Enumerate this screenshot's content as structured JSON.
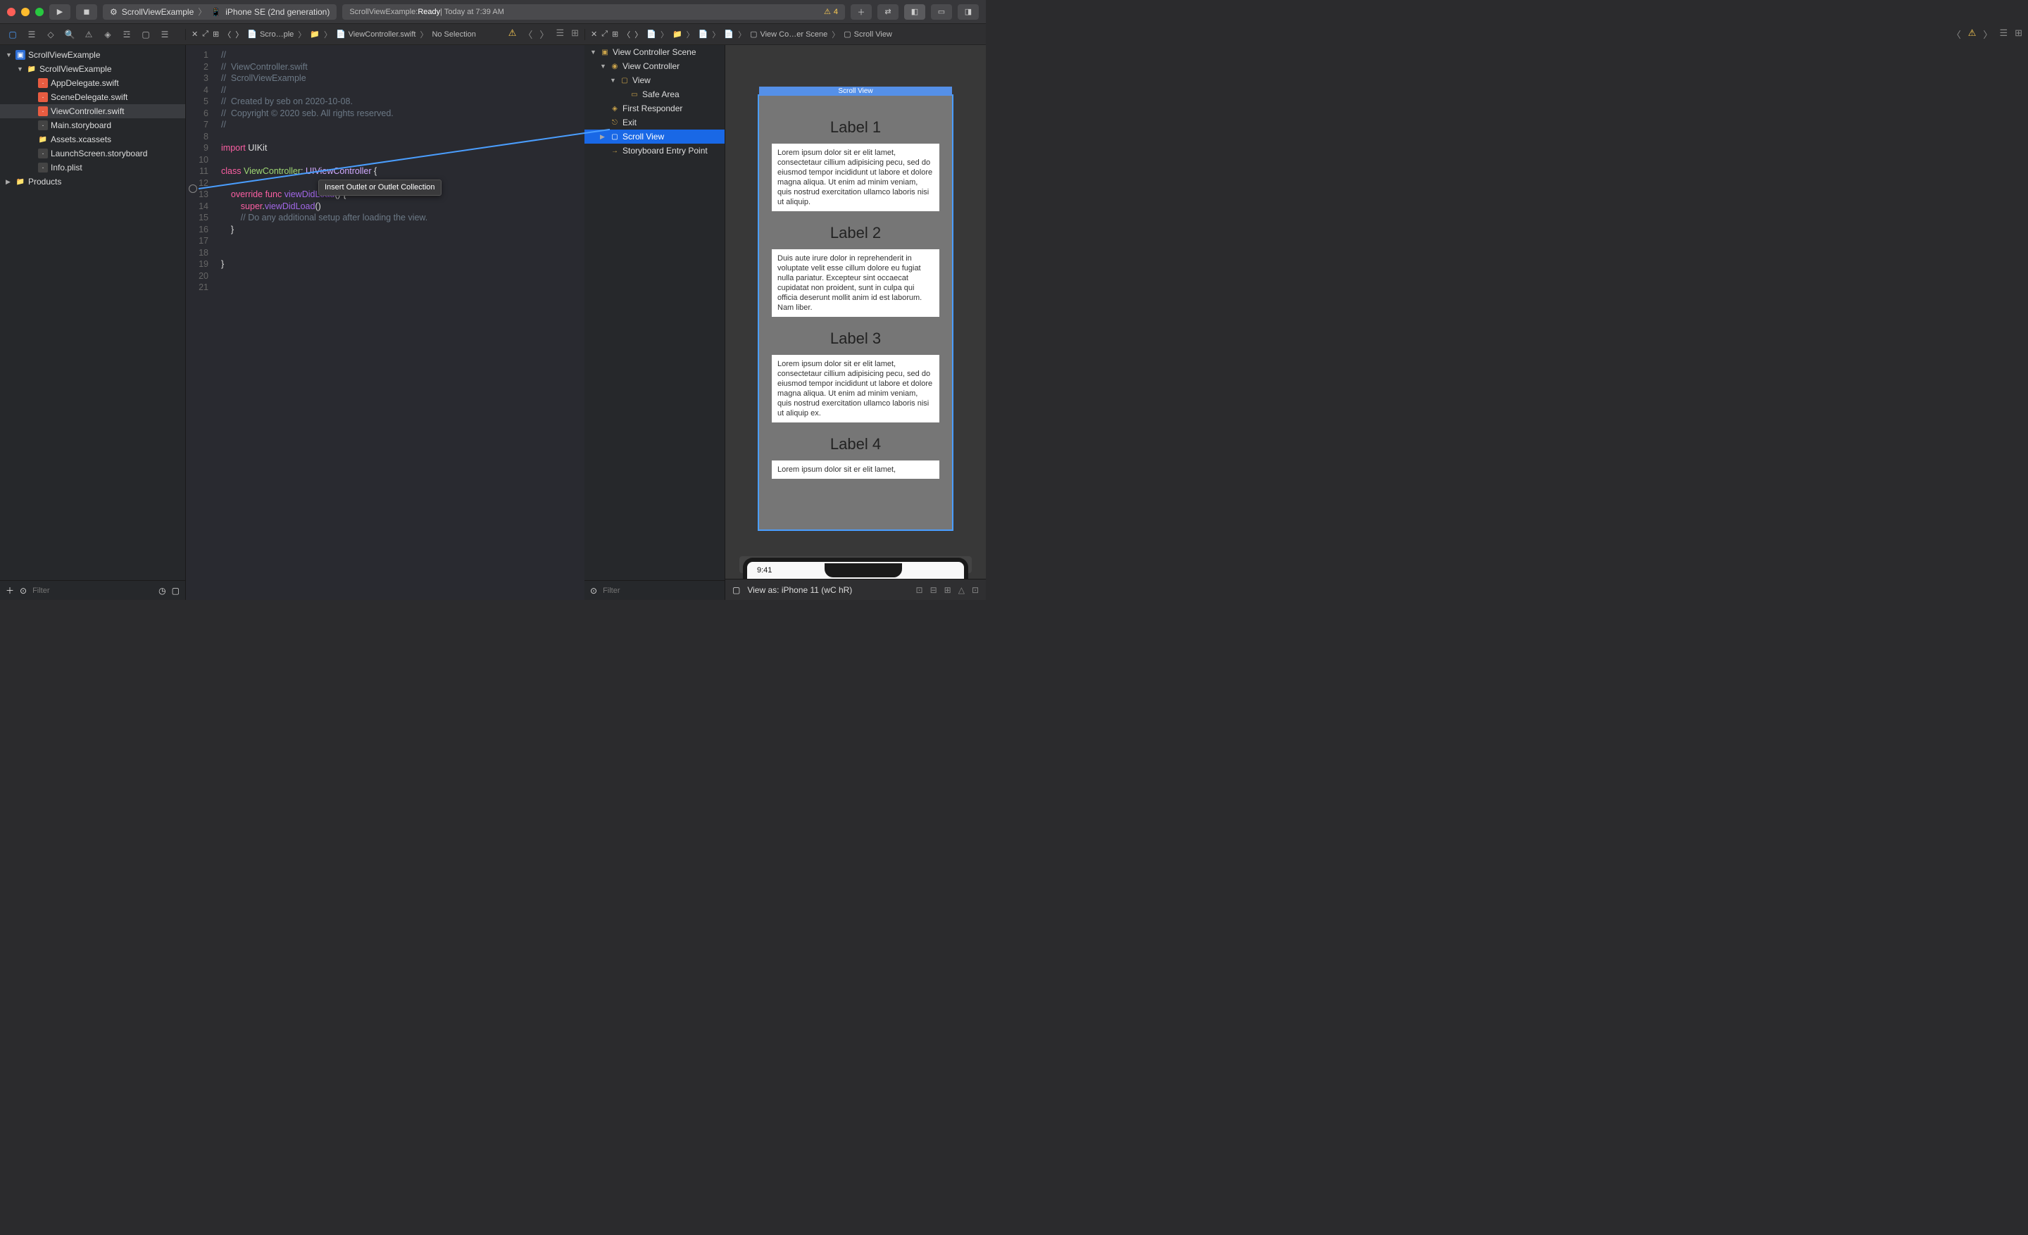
{
  "titlebar": {
    "scheme_project": "ScrollViewExample",
    "scheme_device": "iPhone SE (2nd generation)",
    "status_prefix": "ScrollViewExample: ",
    "status_ready": "Ready",
    "status_suffix": " | Today at 7:39 AM",
    "warnings": "4"
  },
  "nav_tree": [
    {
      "depth": 0,
      "disc": "▼",
      "icon": "proj",
      "label": "ScrollViewExample"
    },
    {
      "depth": 1,
      "disc": "▼",
      "icon": "fold",
      "label": "ScrollViewExample"
    },
    {
      "depth": 2,
      "disc": "",
      "icon": "swift",
      "label": "AppDelegate.swift"
    },
    {
      "depth": 2,
      "disc": "",
      "icon": "swift",
      "label": "SceneDelegate.swift"
    },
    {
      "depth": 2,
      "disc": "",
      "icon": "swift",
      "label": "ViewController.swift",
      "sel": true
    },
    {
      "depth": 2,
      "disc": "",
      "icon": "sb",
      "label": "Main.storyboard"
    },
    {
      "depth": 2,
      "disc": "",
      "icon": "fold",
      "label": "Assets.xcassets"
    },
    {
      "depth": 2,
      "disc": "",
      "icon": "sb",
      "label": "LaunchScreen.storyboard"
    },
    {
      "depth": 2,
      "disc": "",
      "icon": "sb",
      "label": "Info.plist"
    },
    {
      "depth": 0,
      "disc": "▶",
      "icon": "fold",
      "label": "Products"
    }
  ],
  "nav_filter_placeholder": "Filter",
  "jumpbar_left": {
    "file_short": "Scro…ple",
    "file": "ViewController.swift",
    "sel": "No Selection"
  },
  "jumpbar_right": {
    "scene": "View Co…er Scene",
    "sel": "Scroll View"
  },
  "code": {
    "lines": [
      "//",
      "//  ViewController.swift",
      "//  ScrollViewExample",
      "//",
      "//  Created by seb on 2020-10-08.",
      "//  Copyright © 2020 seb. All rights reserved.",
      "//",
      "",
      "import UIKit",
      "",
      "class ViewController: UIViewController {",
      "",
      "    override func viewDidLoad() {",
      "        super.viewDidLoad()",
      "        // Do any additional setup after loading the view.",
      "    }",
      "",
      "",
      "}",
      "",
      ""
    ],
    "tooltip": "Insert Outlet or Outlet Collection"
  },
  "outline": [
    {
      "depth": 0,
      "disc": "▼",
      "icon": "scene",
      "label": "View Controller Scene"
    },
    {
      "depth": 1,
      "disc": "▼",
      "icon": "vc",
      "label": "View Controller"
    },
    {
      "depth": 2,
      "disc": "▼",
      "icon": "view",
      "label": "View"
    },
    {
      "depth": 3,
      "disc": "",
      "icon": "safe",
      "label": "Safe Area"
    },
    {
      "depth": 1,
      "disc": "",
      "icon": "resp",
      "label": "First Responder"
    },
    {
      "depth": 1,
      "disc": "",
      "icon": "exit",
      "label": "Exit"
    },
    {
      "depth": 1,
      "disc": "▶",
      "icon": "view",
      "label": "Scroll View",
      "hl": true
    },
    {
      "depth": 1,
      "disc": "",
      "icon": "entry",
      "label": "Storyboard Entry Point"
    }
  ],
  "outline_filter_placeholder": "Filter",
  "canvas": {
    "sv_title": "Scroll View",
    "labels": [
      "Label 1",
      "Label 2",
      "Label 3",
      "Label 4"
    ],
    "paras": [
      "Lorem ipsum dolor sit er elit lamet, consectetaur cillium adipisicing pecu, sed do eiusmod tempor incididunt ut labore et dolore magna aliqua. Ut enim ad minim veniam, quis nostrud exercitation ullamco laboris nisi ut aliquip.",
      "Duis aute irure dolor in reprehenderit in voluptate velit esse cillum dolore eu fugiat nulla pariatur. Excepteur sint occaecat cupidatat non proident, sunt in culpa qui officia deserunt mollit anim id est laborum. Nam liber.",
      "Lorem ipsum dolor sit er elit lamet, consectetaur cillium adipisicing pecu, sed do eiusmod tempor incididunt ut labore et dolore magna aliqua. Ut enim ad minim veniam, quis nostrud exercitation ullamco laboris nisi ut aliquip ex.",
      "Lorem ipsum dolor sit er elit lamet,"
    ],
    "phone_time": "9:41",
    "bottombar": "View as: iPhone 11 (wC hR)"
  }
}
